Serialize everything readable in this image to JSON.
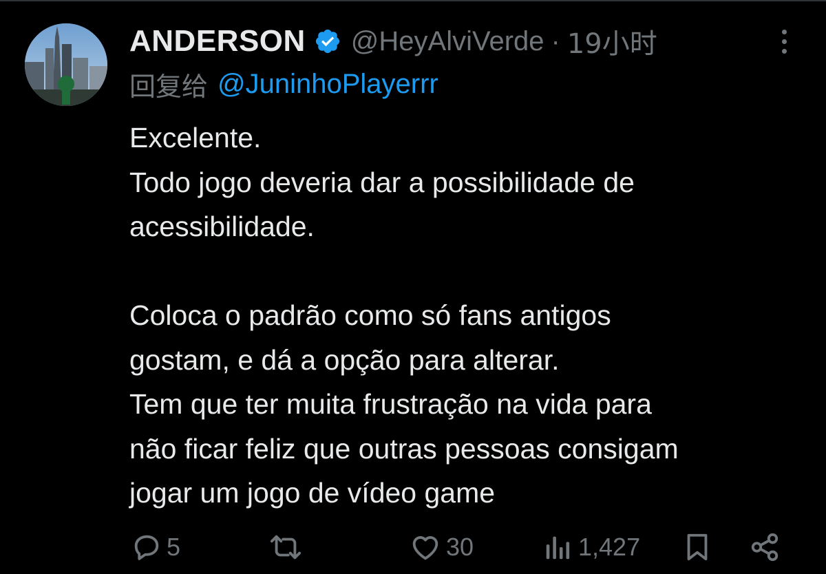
{
  "tweet": {
    "display_name": "ANDERSON",
    "handle": "@HeyAlviVerde",
    "separator": "·",
    "time": "19小时",
    "reply_prefix": "回复给",
    "reply_to": "@JuninhoPlayerrr",
    "paragraphs": [
      [
        "Excelente.",
        "Todo jogo deveria dar a possibilidade de",
        "acessibilidade."
      ],
      [
        "Coloca o padrão como só fans antigos",
        "gostam, e dá a opção para alterar.",
        "Tem que ter muita frustração na vida para",
        "não ficar feliz que outras pessoas consigam",
        "jogar um jogo de vídeo game"
      ]
    ]
  },
  "actions": {
    "replies": "5",
    "retweets": "",
    "likes": "30",
    "views": "1,427"
  },
  "icons": {
    "verified": "verified-badge-icon",
    "more": "more-options-icon",
    "reply": "reply-icon",
    "retweet": "retweet-icon",
    "like": "heart-icon",
    "views": "views-chart-icon",
    "bookmark": "bookmark-icon",
    "share": "share-icon"
  },
  "colors": {
    "background": "#000000",
    "text": "#e7e9ea",
    "muted": "#71767b",
    "accent": "#1d9bf0"
  }
}
